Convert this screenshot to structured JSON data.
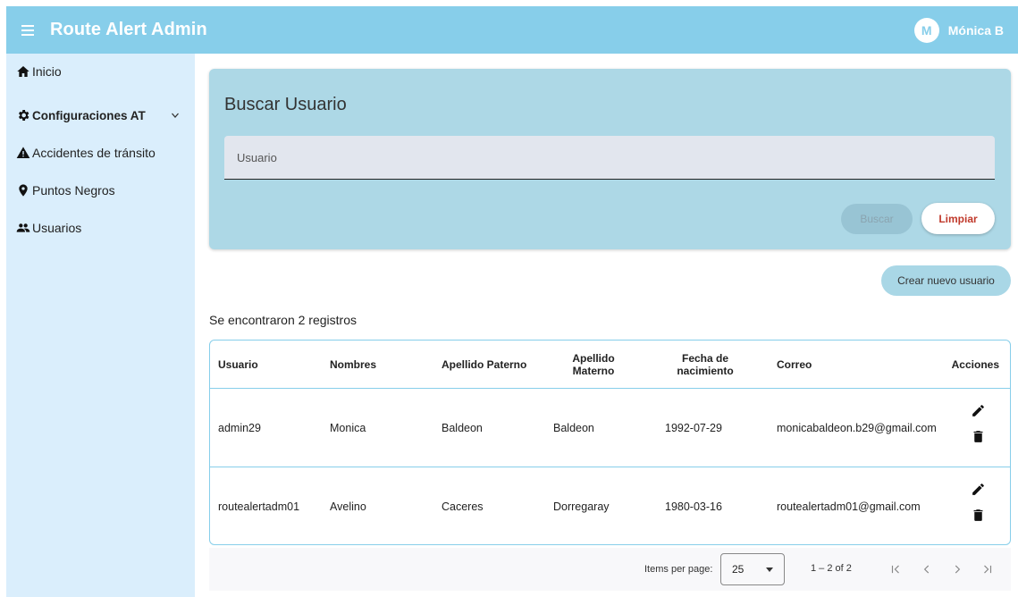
{
  "header": {
    "app_title": "Route Alert Admin",
    "avatar_initial": "M",
    "user_name": "Mónica B"
  },
  "sidebar": {
    "items": [
      {
        "label": "Inicio",
        "icon": "home-icon"
      },
      {
        "label": "Configuraciones AT",
        "icon": "gear-icon"
      },
      {
        "label": "Accidentes de tránsito",
        "icon": "warning-icon"
      },
      {
        "label": "Puntos Negros",
        "icon": "map-pin-icon"
      },
      {
        "label": "Usuarios",
        "icon": "users-icon"
      }
    ]
  },
  "search": {
    "title": "Buscar Usuario",
    "placeholder": "Usuario",
    "value": "",
    "search_label": "Buscar",
    "clear_label": "Limpiar"
  },
  "create_label": "Crear nuevo usuario",
  "result_count": "Se encontraron 2 registros",
  "table": {
    "columns": [
      "Usuario",
      "Nombres",
      "Apellido Paterno",
      "Apellido Materno",
      "Fecha de nacimiento",
      "Correo",
      "Acciones"
    ],
    "rows": [
      {
        "usuario": "admin29",
        "nombres": "Monica",
        "paterno": "Baldeon",
        "materno": "Baldeon",
        "fecha": "1992-07-29",
        "correo": "monicabaldeon.b29@gmail.com"
      },
      {
        "usuario": "routealertadm01",
        "nombres": "Avelino",
        "paterno": "Caceres",
        "materno": "Dorregaray",
        "fecha": "1980-03-16",
        "correo": "routealertadm01@gmail.com"
      }
    ]
  },
  "paginator": {
    "items_per_page_label": "Items per page:",
    "page_size": "25",
    "range": "1 – 2 of 2"
  },
  "colors": {
    "topbar": "#87ceea",
    "sidebar": "#daeefc",
    "search_card": "#add8e6",
    "clear_text": "#c0392b"
  }
}
